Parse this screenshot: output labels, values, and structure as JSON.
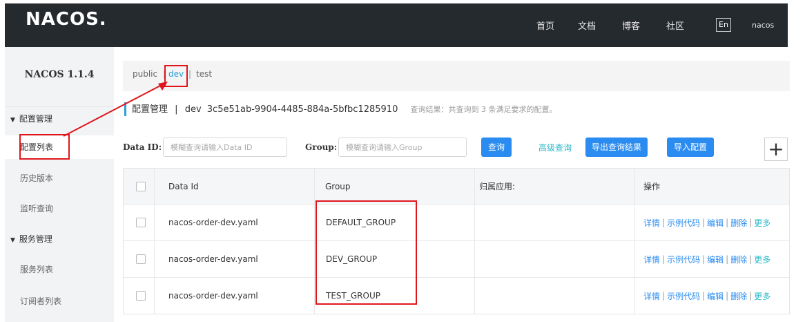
{
  "header": {
    "logo": "NACOS.",
    "nav": [
      "首页",
      "文档",
      "博客",
      "社区"
    ],
    "lang": "En",
    "user": "nacos"
  },
  "sidebar": {
    "version": "NACOS 1.1.4",
    "groups": [
      {
        "label": "配置管理",
        "items": [
          "配置列表",
          "历史版本",
          "监听查询"
        ]
      },
      {
        "label": "服务管理",
        "items": [
          "服务列表",
          "订阅者列表"
        ]
      }
    ]
  },
  "namespaces": [
    "public",
    "dev",
    "test"
  ],
  "page": {
    "title": "配置管理",
    "sep": "|",
    "namespace_name": "dev",
    "namespace_id": "3c5e51ab-9904-4485-884a-5bfbc1285910",
    "result_hint": "查询结果：共查询到 3 条满足要求的配置。"
  },
  "filters": {
    "dataid_label": "Data ID:",
    "dataid_placeholder": "模糊查询请输入Data ID",
    "group_label": "Group:",
    "group_placeholder": "模糊查询请输入Group",
    "query_button": "查询",
    "advanced_link": "高级查询",
    "export_button": "导出查询结果",
    "import_button": "导入配置",
    "add_icon": "plus-icon"
  },
  "table": {
    "columns": [
      "Data Id",
      "Group",
      "归属应用:",
      "操作"
    ],
    "rows": [
      {
        "data_id": "nacos-order-dev.yaml",
        "group": "DEFAULT_GROUP",
        "app": ""
      },
      {
        "data_id": "nacos-order-dev.yaml",
        "group": "DEV_GROUP",
        "app": ""
      },
      {
        "data_id": "nacos-order-dev.yaml",
        "group": "TEST_GROUP",
        "app": ""
      }
    ],
    "actions": {
      "detail": "详情",
      "sample": "示例代码",
      "edit": "编辑",
      "delete": "删除",
      "more": "更多",
      "sep": "|"
    }
  },
  "colors": {
    "accent": "#2a8cf0",
    "link": "#2ab8c7",
    "annotation": "#e0151c",
    "header_bg": "#252a2f"
  }
}
